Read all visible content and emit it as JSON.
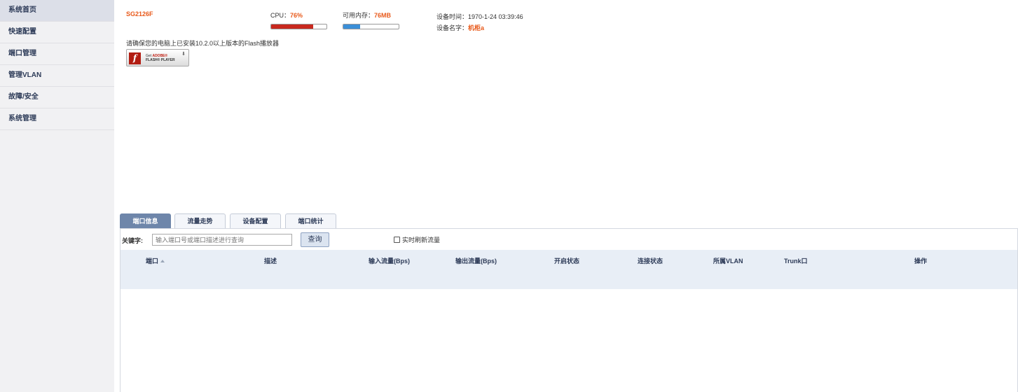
{
  "sidebar": {
    "items": [
      {
        "label": "系统首页"
      },
      {
        "label": "快速配置"
      },
      {
        "label": "端口管理"
      },
      {
        "label": "管理VLAN"
      },
      {
        "label": "故障/安全"
      },
      {
        "label": "系统管理"
      }
    ]
  },
  "status": {
    "model": "SG2126F",
    "cpu_label": "CPU：",
    "cpu_value": "76%",
    "cpu_percent": 76,
    "mem_label": "可用内存：",
    "mem_value": "76MB",
    "mem_bar_fraction": 0.3,
    "time_label": "设备时间：",
    "time_value": "1970-1-24 03:39:46",
    "name_label": "设备名字：",
    "name_value": "机柜a"
  },
  "flash": {
    "note": "请确保您的电脑上已安装10.2.0以上版本的Flash播放器",
    "badge_get": "Get",
    "badge_adobe": "ADOBE®",
    "badge_player": "FLASH® PLAYER"
  },
  "tabs": [
    {
      "label": "端口信息"
    },
    {
      "label": "流量走势"
    },
    {
      "label": "设备配置"
    },
    {
      "label": "端口统计"
    }
  ],
  "search": {
    "label": "关键字:",
    "placeholder": "输入端口号或端口描述进行查询",
    "button": "查询",
    "realtime_label": "实时刷新流量"
  },
  "table": {
    "columns": [
      "端口",
      "描述",
      "输入流量(Bps)",
      "输出流量(Bps)",
      "开启状态",
      "连接状态",
      "所属VLAN",
      "Trunk口",
      "操作"
    ]
  },
  "colors": {
    "accent": "#e8591a",
    "cpu_bar": "#c8281e",
    "mem_bar": "#3b8fd8",
    "tab_active": "#6e86aa",
    "sidebar_bg": "#f1f1f3"
  }
}
